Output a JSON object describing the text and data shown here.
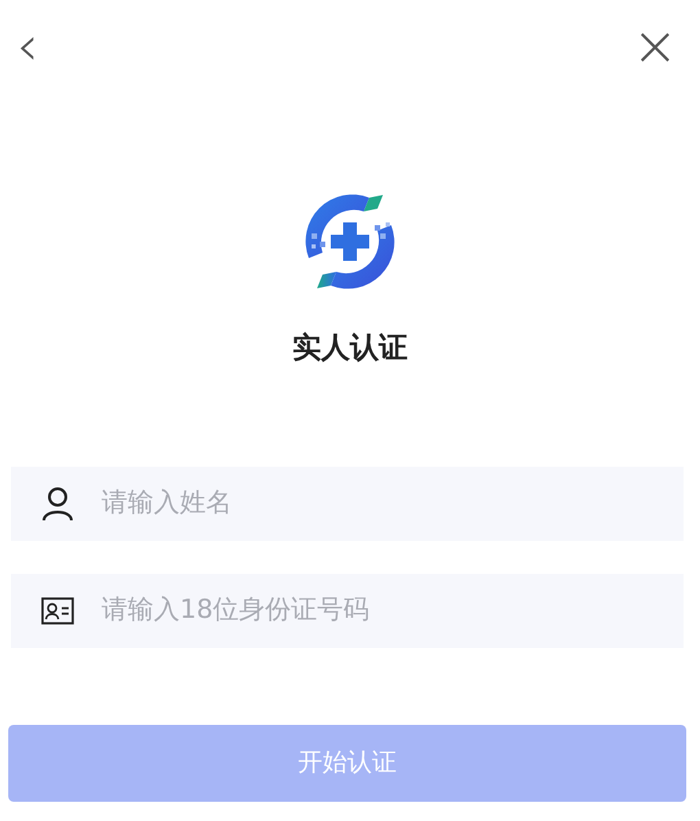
{
  "header": {
    "back": "‹",
    "close": "×"
  },
  "title": "实人认证",
  "fields": [
    {
      "kind": "name",
      "placeholder": "请输入姓名"
    },
    {
      "kind": "id-card",
      "placeholder": "请输入18位身份证号码"
    }
  ],
  "submit": {
    "label": "开始认证",
    "disabled": true
  }
}
